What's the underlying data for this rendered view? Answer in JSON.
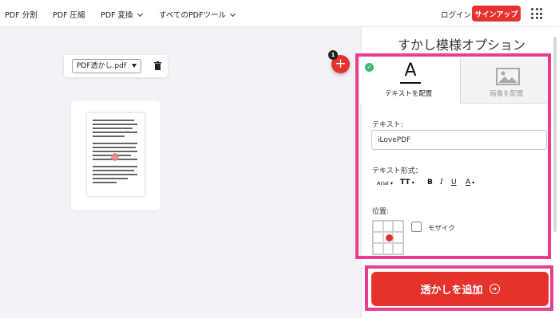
{
  "nav": {
    "items": [
      {
        "label": "PDF 分割"
      },
      {
        "label": "PDF 圧縮"
      },
      {
        "label": "PDF 変換"
      },
      {
        "label": "すべてのPDFツール"
      }
    ],
    "login": "ログイン",
    "signup": "サインアップ",
    "apps_icon": "grid-icon"
  },
  "file_toolbar": {
    "selected_file": "PDF透かし.pdf",
    "delete_icon": "trash-icon"
  },
  "add_files": {
    "badge_count": "1",
    "icon": "plus-icon"
  },
  "sidebar": {
    "title": "すかし模様オプション",
    "tabs": [
      {
        "label": "テキストを配置",
        "icon": "text-a-icon",
        "active": true
      },
      {
        "label": "画像を配置",
        "icon": "image-icon",
        "active": false
      }
    ],
    "text_label": "テキスト:",
    "text_value": "iLovePDF",
    "format_label": "テキスト形式：",
    "format": {
      "font": "Arial",
      "size_icon": "TT",
      "bold": "B",
      "italic": "I",
      "underline": "U",
      "color": "A"
    },
    "position_label": "位置:",
    "position_selected": "middle-center",
    "mosaic_label": "モザイク",
    "add_button": "透かしを追加"
  },
  "colors": {
    "accent": "#e5322d",
    "highlight": "#e83e8c",
    "check": "#3db87a"
  }
}
